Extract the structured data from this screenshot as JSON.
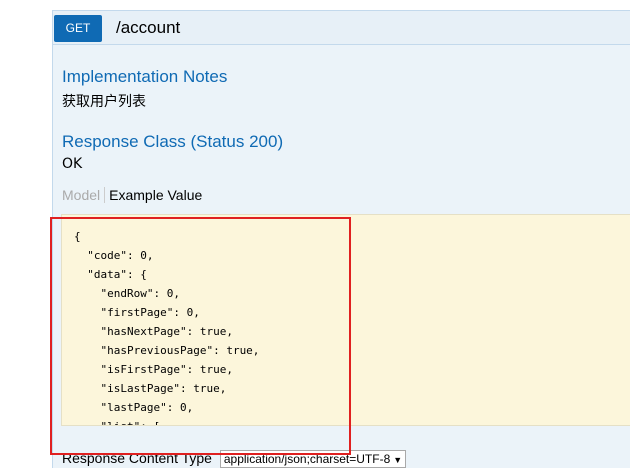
{
  "operation": {
    "method": "GET",
    "path": "/account"
  },
  "implementation_notes": {
    "heading": "Implementation Notes",
    "text": "获取用户列表"
  },
  "response_class": {
    "heading": "Response Class (Status 200)",
    "text": "OK"
  },
  "tabs": {
    "model": "Model",
    "example": "Example Value"
  },
  "example_value_lines": [
    "{",
    "  \"code\": 0,",
    "  \"data\": {",
    "    \"endRow\": 0,",
    "    \"firstPage\": 0,",
    "    \"hasNextPage\": true,",
    "    \"hasPreviousPage\": true,",
    "    \"isFirstPage\": true,",
    "    \"isLastPage\": true,",
    "    \"lastPage\": 0,",
    "    \"list\": ["
  ],
  "response_content_type": {
    "label": "Response Content Type",
    "selected": "application/json;charset=UTF-8"
  },
  "colors": {
    "method_get": "#0f6ab4",
    "heading": "#0f6ab4",
    "code_bg": "#fcf6db",
    "highlight_box": "#e02020"
  }
}
